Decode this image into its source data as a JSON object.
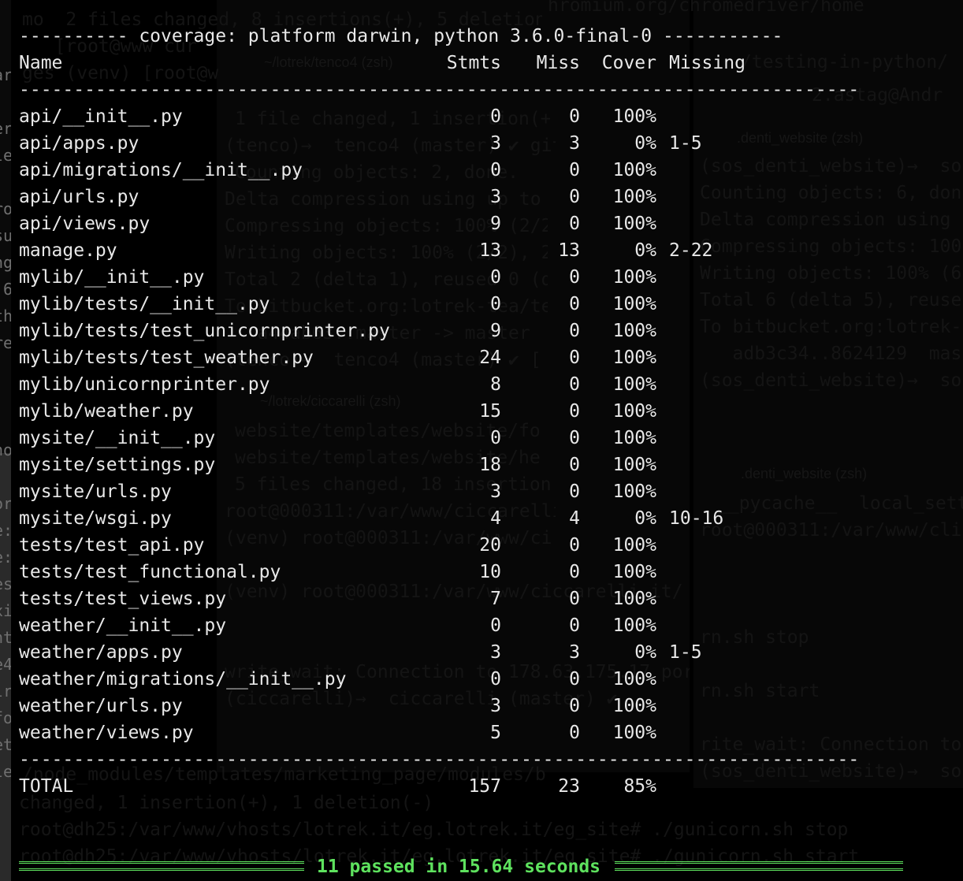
{
  "header": {
    "title_line": "---------- coverage: platform darwin, python 3.6.0-final-0 -----------",
    "separator": "-----------------------------------------------------------------------------",
    "columns": {
      "name": "Name",
      "stmts": "Stmts",
      "miss": "Miss",
      "cover": "Cover",
      "missing": "Missing"
    }
  },
  "rows": [
    {
      "name": "api/__init__.py",
      "stmts": "0",
      "miss": "0",
      "cover": "100%",
      "missing": ""
    },
    {
      "name": "api/apps.py",
      "stmts": "3",
      "miss": "3",
      "cover": "0%",
      "missing": "1-5"
    },
    {
      "name": "api/migrations/__init__.py",
      "stmts": "0",
      "miss": "0",
      "cover": "100%",
      "missing": ""
    },
    {
      "name": "api/urls.py",
      "stmts": "3",
      "miss": "0",
      "cover": "100%",
      "missing": ""
    },
    {
      "name": "api/views.py",
      "stmts": "9",
      "miss": "0",
      "cover": "100%",
      "missing": ""
    },
    {
      "name": "manage.py",
      "stmts": "13",
      "miss": "13",
      "cover": "0%",
      "missing": "2-22"
    },
    {
      "name": "mylib/__init__.py",
      "stmts": "0",
      "miss": "0",
      "cover": "100%",
      "missing": ""
    },
    {
      "name": "mylib/tests/__init__.py",
      "stmts": "0",
      "miss": "0",
      "cover": "100%",
      "missing": ""
    },
    {
      "name": "mylib/tests/test_unicornprinter.py",
      "stmts": "9",
      "miss": "0",
      "cover": "100%",
      "missing": ""
    },
    {
      "name": "mylib/tests/test_weather.py",
      "stmts": "24",
      "miss": "0",
      "cover": "100%",
      "missing": ""
    },
    {
      "name": "mylib/unicornprinter.py",
      "stmts": "8",
      "miss": "0",
      "cover": "100%",
      "missing": ""
    },
    {
      "name": "mylib/weather.py",
      "stmts": "15",
      "miss": "0",
      "cover": "100%",
      "missing": ""
    },
    {
      "name": "mysite/__init__.py",
      "stmts": "0",
      "miss": "0",
      "cover": "100%",
      "missing": ""
    },
    {
      "name": "mysite/settings.py",
      "stmts": "18",
      "miss": "0",
      "cover": "100%",
      "missing": ""
    },
    {
      "name": "mysite/urls.py",
      "stmts": "3",
      "miss": "0",
      "cover": "100%",
      "missing": ""
    },
    {
      "name": "mysite/wsgi.py",
      "stmts": "4",
      "miss": "4",
      "cover": "0%",
      "missing": "10-16"
    },
    {
      "name": "tests/test_api.py",
      "stmts": "20",
      "miss": "0",
      "cover": "100%",
      "missing": ""
    },
    {
      "name": "tests/test_functional.py",
      "stmts": "10",
      "miss": "0",
      "cover": "100%",
      "missing": ""
    },
    {
      "name": "tests/test_views.py",
      "stmts": "7",
      "miss": "0",
      "cover": "100%",
      "missing": ""
    },
    {
      "name": "weather/__init__.py",
      "stmts": "0",
      "miss": "0",
      "cover": "100%",
      "missing": ""
    },
    {
      "name": "weather/apps.py",
      "stmts": "3",
      "miss": "3",
      "cover": "0%",
      "missing": "1-5"
    },
    {
      "name": "weather/migrations/__init__.py",
      "stmts": "0",
      "miss": "0",
      "cover": "100%",
      "missing": ""
    },
    {
      "name": "weather/urls.py",
      "stmts": "3",
      "miss": "0",
      "cover": "100%",
      "missing": ""
    },
    {
      "name": "weather/views.py",
      "stmts": "5",
      "miss": "0",
      "cover": "100%",
      "missing": ""
    }
  ],
  "total": {
    "name": "TOTAL",
    "stmts": "157",
    "miss": "23",
    "cover": "85%"
  },
  "summary": {
    "text": "11 passed in 15.64 seconds"
  },
  "background": {
    "line_1": "mo  2 files changed, 8 insertions(+), 5 deletions(-)",
    "line_2": "hromium.org/chromedriver/home",
    "line_3": "   [root@www cur",
    "line_4": "~/lotrek/tenco4 (zsh)",
    "line_5": "/testing-in-python/",
    "line_6": "ges (venv) [root@w",
    "line_7": "2.astag@Andr",
    "line_8": "1 file changed, 1 insertion(+)",
    "line_9": ".denti_website (zsh)",
    "line_10": "(tenco)→  tenco4 (master) ✔ git push",
    "line_11": "(sos_denti_website)→  so",
    "line_12": "Counting objects: 2, done.",
    "line_13": "Counting objects: 6, don",
    "line_14": "Delta compression using up to 4 threads.",
    "line_15": "Delta compression using",
    "line_16": "Compressing objects: 100% (2/2), done.",
    "line_17": "Compressing objects: 100",
    "line_18": "Writing objects: 100% (2/2), 240 bytes",
    "line_19": "Writing objects: 100% (6",
    "line_20": "Total 2 (delta 1), reused 0 (delta 0)",
    "line_21": "Total 6 (delta 5), reuse",
    "line_22": "To bitbucket.org:lotrek-tea/tenco4.git",
    "line_23": "To bitbucket.org:lotrek-",
    "line_24": "   a44ab63..master -> master",
    "line_25": "   adb3c34..8624129  mas",
    "line_26": "(tenco)→  tenco4 (master) ✔ [",
    "line_27": "(sos_denti_website)→  so",
    "line_28": "~/lotrek/ciccarelli (zsh)",
    "line_29": "website/templates/website/fo",
    "line_30": "website/templates/website/he",
    "line_31": "5 files changed, 18 insertions",
    "line_32": ".denti_website (zsh)",
    "line_33": "root@000311:/var/www/ciccarelli",
    "line_34": "__pycache__  local_setti",
    "line_35": "(venv) root@000311:/var/www/ci",
    "line_36": "root@000311:/var/www/cli",
    "line_37": "(venv) root@000311:/var/www/ciccarelli.it/",
    "line_38": "rn.sh stop",
    "line_39": "write_wait: Connection to 178.63.175.17 port 22:",
    "line_40": "rn.sh start",
    "line_41": "(ciccarelli)→  ciccarelli (master) ✔",
    "line_42": "rite_wait: Connection to",
    "line_43": "(sos_denti_website)→  so",
    "line_44": "/node_modules/templates/marketing_page/modules/b",
    "line_45": "changed, 1 insertion(+), 1 deletion(-)",
    "line_46": "root@dh25:/var/www/vhosts/lotrek.it/eg.lotrek.it/eg_site# ./gunicorn.sh stop",
    "line_47": "root@dh25:/var/www/vhosts/lotrek.it/eg.lotrek.it/eg_site# ./gunicorn.sh start"
  },
  "left_edge": {
    "chars": "ar\n\ner\nle\n\nro\nsu\nng\n 6\nth\nre\n\n\n\nno\n)\nor\ne:\ne:\nes\nxi\nnt\ne4\nlr\nfo\net\nle\n)\n)"
  },
  "colors": {
    "background": "#000000",
    "text": "#e8e8e8",
    "pass_green": "#5ee25e"
  }
}
